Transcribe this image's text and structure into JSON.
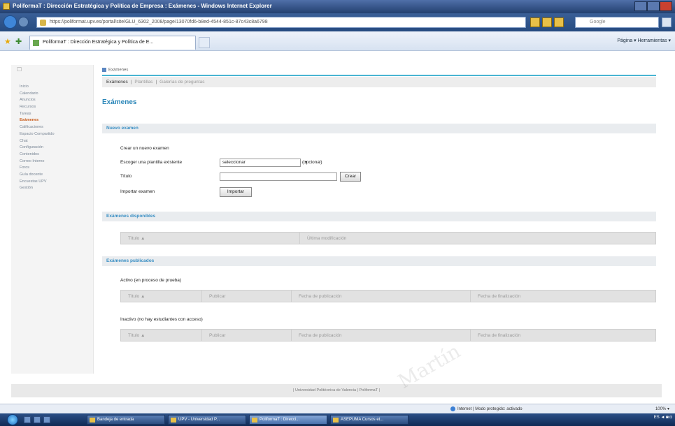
{
  "window": {
    "title": "PoliformaT : Dirección Estratégica y Política de Empresa : Exámenes - Windows Internet Explorer"
  },
  "addressbar": {
    "url": "https://poliformat.upv.es/portal/site/GLU_6302_2008/page/13070fd6-b8ed-4544-851c-87c43c8a6798",
    "search_placeholder": "Google"
  },
  "tabs": {
    "active_label": "PoliformaT : Dirección Estratégica y Política de E...",
    "toolbar_right": "Página ▾  Herramientas ▾"
  },
  "sidebar": {
    "items": [
      {
        "label": "Inicio"
      },
      {
        "label": "Calendario"
      },
      {
        "label": "Anuncios"
      },
      {
        "label": "Recursos"
      },
      {
        "label": "Tareas"
      },
      {
        "label": "Exámenes",
        "active": true
      },
      {
        "label": "Calificaciones"
      },
      {
        "label": "Espacio Compartido"
      },
      {
        "label": "Chat"
      },
      {
        "label": "Configuración"
      },
      {
        "label": "Contenidos"
      },
      {
        "label": "Correo Interno"
      },
      {
        "label": "Foros"
      },
      {
        "label": "Guía docente"
      },
      {
        "label": "Encuestas UPV"
      },
      {
        "label": "Gestión"
      }
    ]
  },
  "breadcrumb": {
    "label": "Exámenes"
  },
  "subtabs": {
    "current": "Exámenes",
    "items": [
      "Plantillas",
      "Galerías de preguntas"
    ],
    "sep": "|"
  },
  "main": {
    "page_title": "Exámenes",
    "new_exam": {
      "section_title": "Nuevo examen",
      "create_label": "Crear un nuevo examen",
      "template_label": "Escoger una plantilla existente",
      "template_select": "seleccionar",
      "template_optional": "(opcional)",
      "title_label": "Título",
      "create_button": "Crear",
      "import_label": "Importar examen",
      "import_button": "Importar"
    },
    "available": {
      "section_title": "Exámenes disponibles",
      "columns": [
        "Título ▲",
        "Última modificación"
      ]
    },
    "published": {
      "section_title": "Exámenes publicados",
      "active_label": "Activo (en proceso de prueba)",
      "active_columns": [
        "Título ▲",
        "Publicar",
        "Fecha de publicación",
        "Fecha de finalización"
      ],
      "inactive_label": "Inactivo (no hay estudiantes con acceso)",
      "inactive_columns": [
        "Título ▲",
        "Publicar",
        "Fecha de publicación",
        "Fecha de finalización"
      ]
    }
  },
  "footer": {
    "text": "|   Universidad Politécnica de Valencia   |   PoliformaT   |"
  },
  "statusbar": {
    "zone": "Internet | Modo protegido: activado",
    "zoom": "100% ▾"
  },
  "taskbar": {
    "tasks": [
      {
        "label": "Bandeja de entrada"
      },
      {
        "label": "UPV - Universidad P..."
      },
      {
        "label": "PoliformaT : Direcci...",
        "active": true
      },
      {
        "label": "ASEPUMA Cursos et..."
      }
    ],
    "tray": "ES  ◄ ◙ ◘"
  },
  "watermark": "Martín",
  "colors": {
    "accent": "#2a86b8",
    "active_menu": "#c85b19",
    "rule": "#49b5d2"
  }
}
